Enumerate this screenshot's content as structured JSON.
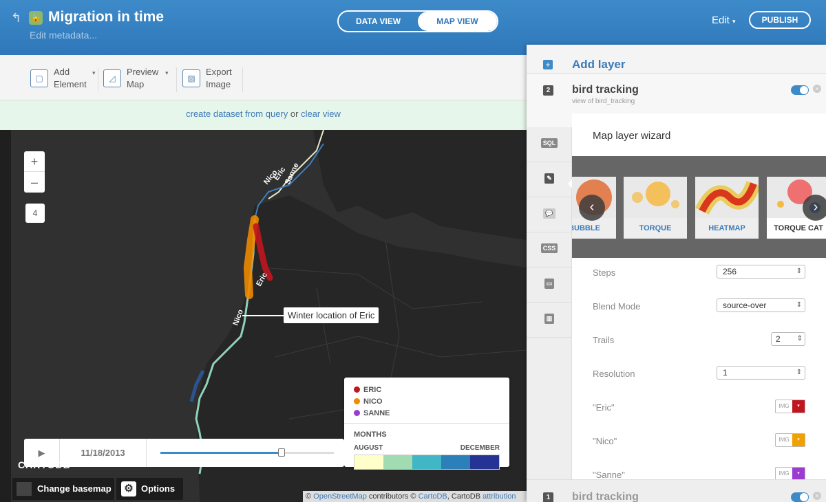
{
  "header": {
    "title": "Migration in time",
    "edit_metadata": "Edit metadata...",
    "view_toggle": {
      "data_view": "DATA VIEW",
      "map_view": "MAP VIEW"
    },
    "edit_menu": "Edit",
    "publish": "PUBLISH"
  },
  "toolbar": {
    "add_element": "Add Element",
    "preview_map": "Preview Map",
    "export_image": "Export Image"
  },
  "query_bar": {
    "create_dataset": "create dataset from query",
    "or": "or",
    "clear_view": "clear view"
  },
  "map": {
    "zoom_in": "+",
    "zoom_out": "–",
    "zoom_level": "4",
    "annotation": "Winter location of Eric",
    "labels": {
      "nico": "Nico",
      "eric": "Eric",
      "sanne": "Sanne"
    },
    "logo": "CARTODB",
    "change_basemap": "Change basemap",
    "options": "Options",
    "attribution": {
      "prefix": "©",
      "osm": "OpenStreetMap",
      "contributors": "contributors ©",
      "cartodb": "CartoDB",
      "cartodb_plain": ", CartoDB",
      "attr": "attribution"
    },
    "colors": {
      "eric": "#c0161f",
      "nico": "#f08a00",
      "sanne": "#9b3bd0"
    }
  },
  "legend": {
    "categories": [
      {
        "label": "ERIC",
        "color": "#c0161f"
      },
      {
        "label": "NICO",
        "color": "#f08a00"
      },
      {
        "label": "SANNE",
        "color": "#9b3bd0"
      }
    ],
    "months_title": "MONTHS",
    "from": "AUGUST",
    "to": "DECEMBER",
    "ramp": [
      "#ffffc9",
      "#a1dbb2",
      "#41b6c4",
      "#2c7fb8",
      "#253494"
    ]
  },
  "timeline": {
    "play": "▶",
    "date": "11/18/2013",
    "progress": 0.7
  },
  "panel": {
    "add_layer": "Add layer",
    "layer": {
      "number": "2",
      "name": "bird tracking",
      "subtitle": "view of bird_tracking"
    },
    "side_icons": [
      "SQL",
      "wizard",
      "infowindow",
      "CSS",
      "legend",
      "filters"
    ],
    "wizard": {
      "title": "Map layer wizard",
      "types": [
        {
          "label": "BUBBLE"
        },
        {
          "label": "TORQUE"
        },
        {
          "label": "HEATMAP"
        },
        {
          "label": "TORQUE CAT"
        }
      ],
      "fields": {
        "steps": {
          "label": "Steps",
          "value": "256"
        },
        "blend": {
          "label": "Blend Mode",
          "value": "source-over"
        },
        "trails": {
          "label": "Trails",
          "value": "2"
        },
        "resolution": {
          "label": "Resolution",
          "value": "1"
        },
        "eric": {
          "label": "\"Eric\"",
          "img": "IMG",
          "color": "#c0161f"
        },
        "nico": {
          "label": "\"Nico\"",
          "img": "IMG",
          "color": "#f0a000"
        },
        "sanne": {
          "label": "\"Sanne\"",
          "img": "IMG",
          "color": "#9b3bd0"
        }
      }
    },
    "layer2": {
      "number": "1",
      "name": "bird tracking"
    }
  }
}
